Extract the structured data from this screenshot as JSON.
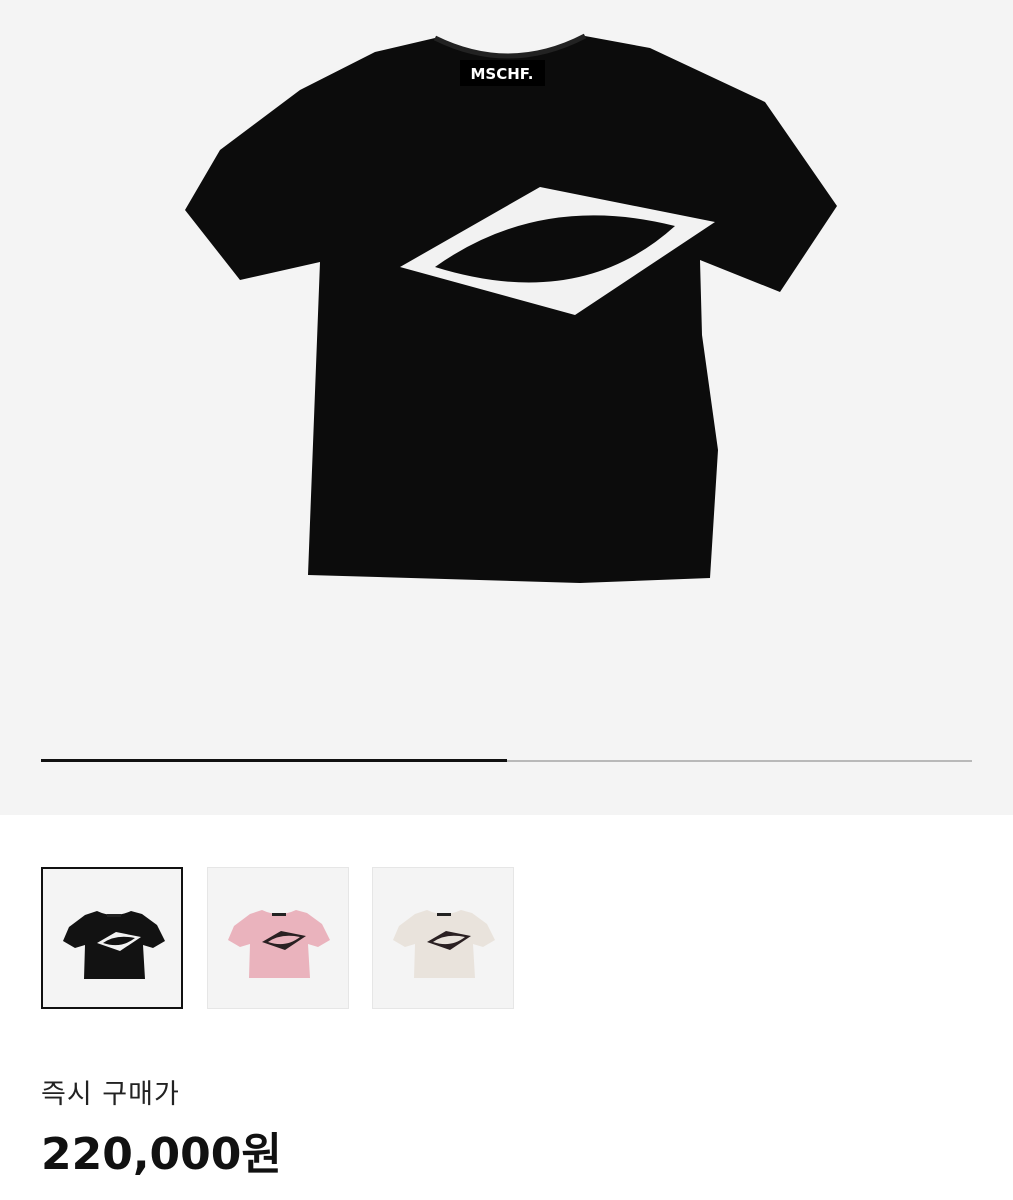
{
  "product": {
    "brand_label": "MSCHF.",
    "gallery_progress": 0.5
  },
  "thumbnails": [
    {
      "color": "#121212",
      "graphic": "#f2f2f2",
      "selected": true
    },
    {
      "color": "#eab3bd",
      "graphic": "#2a2022",
      "selected": false
    },
    {
      "color": "#e9e3dc",
      "graphic": "#2a2022",
      "selected": false
    }
  ],
  "price": {
    "label": "즉시 구매가",
    "value": "220,000원"
  },
  "colors": {
    "hero_background": "#f4f4f4",
    "progress_fill": "#111111",
    "progress_track": "#b9b9b9"
  }
}
